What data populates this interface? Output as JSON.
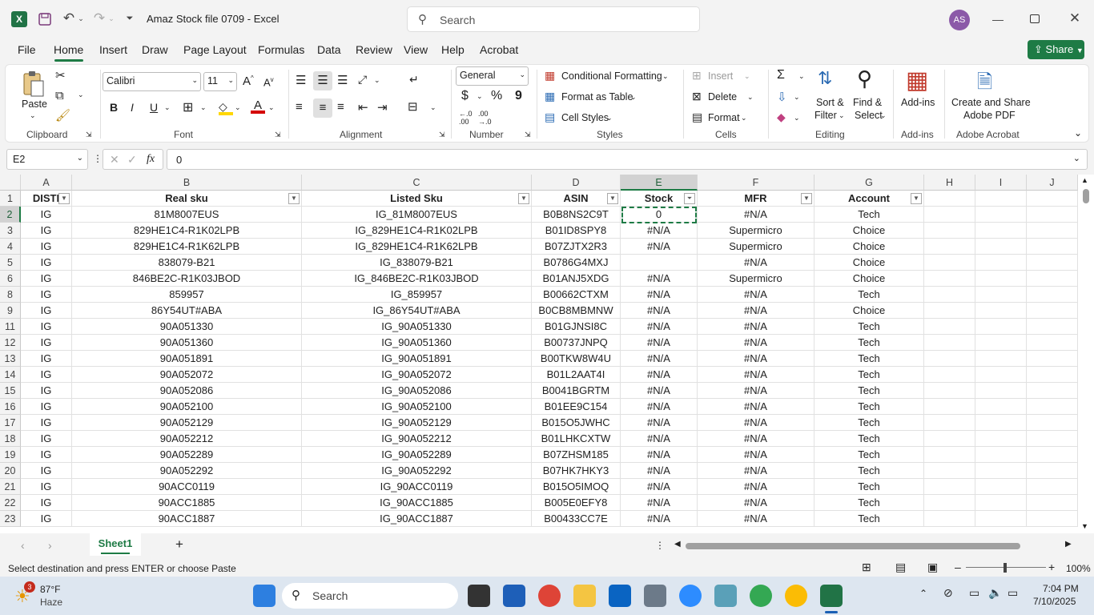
{
  "titlebar": {
    "filename": "Amaz Stock file 0709",
    "sep": "-",
    "app": "Excel",
    "search_placeholder": "Search",
    "avatar": "AS"
  },
  "menu": [
    "File",
    "Home",
    "Insert",
    "Draw",
    "Page Layout",
    "Formulas",
    "Data",
    "Review",
    "View",
    "Help",
    "Acrobat"
  ],
  "share_label": "Share",
  "ribbon": {
    "clipboard": {
      "paste": "Paste",
      "label": "Clipboard"
    },
    "font": {
      "name": "Calibri",
      "size": "11",
      "bold": "B",
      "italic": "I",
      "underline": "U",
      "label": "Font"
    },
    "alignment": {
      "label": "Alignment"
    },
    "number": {
      "format": "General",
      "currency": "$",
      "percent": "%",
      "comma": "9",
      "label": "Number"
    },
    "styles": {
      "conditional": "Conditional Formatting",
      "table": "Format as Table",
      "cell": "Cell Styles",
      "label": "Styles"
    },
    "cells": {
      "insert": "Insert",
      "delete": "Delete",
      "format": "Format",
      "label": "Cells"
    },
    "editing": {
      "sort1": "Sort &",
      "sort2": "Filter",
      "find1": "Find &",
      "find2": "Select",
      "label": "Editing"
    },
    "addins": {
      "btn": "Add-ins",
      "label": "Add-ins"
    },
    "acrobat": {
      "btn1": "Create and Share",
      "btn2": "Adobe PDF",
      "label": "Adobe Acrobat"
    }
  },
  "formula": {
    "namebox": "E2",
    "value": "0",
    "fx": "fx"
  },
  "columns": [
    {
      "letter": "A",
      "w": 64
    },
    {
      "letter": "B",
      "w": 287
    },
    {
      "letter": "C",
      "w": 287
    },
    {
      "letter": "D",
      "w": 111
    },
    {
      "letter": "E",
      "w": 96
    },
    {
      "letter": "F",
      "w": 146
    },
    {
      "letter": "G",
      "w": 137
    },
    {
      "letter": "H",
      "w": 64
    },
    {
      "letter": "I",
      "w": 64
    },
    {
      "letter": "J",
      "w": 64
    }
  ],
  "headers": [
    "DISTI",
    "Real sku",
    "Listed Sku",
    "ASIN",
    "Stock",
    "MFR",
    "Account"
  ],
  "rows": [
    {
      "n": "2",
      "c": [
        "IG",
        "81M8007EUS",
        "IG_81M8007EUS",
        "B0B8NS2C9T",
        "0",
        "#N/A",
        "Tech"
      ]
    },
    {
      "n": "3",
      "c": [
        "IG",
        "829HE1C4-R1K02LPB",
        "IG_829HE1C4-R1K02LPB",
        "B01ID8SPY8",
        "#N/A",
        "Supermicro",
        "Choice"
      ]
    },
    {
      "n": "4",
      "c": [
        "IG",
        "829HE1C4-R1K62LPB",
        "IG_829HE1C4-R1K62LPB",
        "B07ZJTX2R3",
        "#N/A",
        "Supermicro",
        "Choice"
      ]
    },
    {
      "n": "5",
      "c": [
        "IG",
        "838079-B21",
        "IG_838079-B21",
        "B0786G4MXJ",
        "",
        "#N/A",
        "Choice"
      ]
    },
    {
      "n": "6",
      "c": [
        "IG",
        "846BE2C-R1K03JBOD",
        "IG_846BE2C-R1K03JBOD",
        "B01ANJ5XDG",
        "#N/A",
        "Supermicro",
        "Choice"
      ]
    },
    {
      "n": "8",
      "c": [
        "IG",
        "859957",
        "IG_859957",
        "B00662CTXM",
        "#N/A",
        "#N/A",
        "Tech"
      ]
    },
    {
      "n": "9",
      "c": [
        "IG",
        "86Y54UT#ABA",
        "IG_86Y54UT#ABA",
        "B0CB8MBMNW",
        "#N/A",
        "#N/A",
        "Choice"
      ]
    },
    {
      "n": "11",
      "c": [
        "IG",
        "90A051330",
        "IG_90A051330",
        "B01GJNSI8C",
        "#N/A",
        "#N/A",
        "Tech"
      ]
    },
    {
      "n": "12",
      "c": [
        "IG",
        "90A051360",
        "IG_90A051360",
        "B00737JNPQ",
        "#N/A",
        "#N/A",
        "Tech"
      ]
    },
    {
      "n": "13",
      "c": [
        "IG",
        "90A051891",
        "IG_90A051891",
        "B00TKW8W4U",
        "#N/A",
        "#N/A",
        "Tech"
      ]
    },
    {
      "n": "14",
      "c": [
        "IG",
        "90A052072",
        "IG_90A052072",
        "B01L2AAT4I",
        "#N/A",
        "#N/A",
        "Tech"
      ]
    },
    {
      "n": "15",
      "c": [
        "IG",
        "90A052086",
        "IG_90A052086",
        "B0041BGRTM",
        "#N/A",
        "#N/A",
        "Tech"
      ]
    },
    {
      "n": "16",
      "c": [
        "IG",
        "90A052100",
        "IG_90A052100",
        "B01EE9C154",
        "#N/A",
        "#N/A",
        "Tech"
      ]
    },
    {
      "n": "17",
      "c": [
        "IG",
        "90A052129",
        "IG_90A052129",
        "B015O5JWHC",
        "#N/A",
        "#N/A",
        "Tech"
      ]
    },
    {
      "n": "18",
      "c": [
        "IG",
        "90A052212",
        "IG_90A052212",
        "B01LHKCXTW",
        "#N/A",
        "#N/A",
        "Tech"
      ]
    },
    {
      "n": "19",
      "c": [
        "IG",
        "90A052289",
        "IG_90A052289",
        "B07ZHSM185",
        "#N/A",
        "#N/A",
        "Tech"
      ]
    },
    {
      "n": "20",
      "c": [
        "IG",
        "90A052292",
        "IG_90A052292",
        "B07HK7HKY3",
        "#N/A",
        "#N/A",
        "Tech"
      ]
    },
    {
      "n": "21",
      "c": [
        "IG",
        "90ACC0119",
        "IG_90ACC0119",
        "B015O5IMOQ",
        "#N/A",
        "#N/A",
        "Tech"
      ]
    },
    {
      "n": "22",
      "c": [
        "IG",
        "90ACC1885",
        "IG_90ACC1885",
        "B005E0EFY8",
        "#N/A",
        "#N/A",
        "Tech"
      ]
    },
    {
      "n": "23",
      "c": [
        "IG",
        "90ACC1887",
        "IG_90ACC1887",
        "B00433CC7E",
        "#N/A",
        "#N/A",
        "Tech"
      ]
    }
  ],
  "sheet": {
    "name": "Sheet1",
    "add": "+"
  },
  "status": {
    "message": "Select destination and press ENTER or choose Paste",
    "zoom": "100%"
  },
  "taskbar": {
    "temp": "87°F",
    "weather": "Haze",
    "badge": "3",
    "search": "Search",
    "time": "7:04 PM",
    "date": "7/10/2025"
  },
  "colors": {
    "excel_green": "#217346",
    "share_green": "#1e7b45",
    "accent": "#1f6e43"
  }
}
